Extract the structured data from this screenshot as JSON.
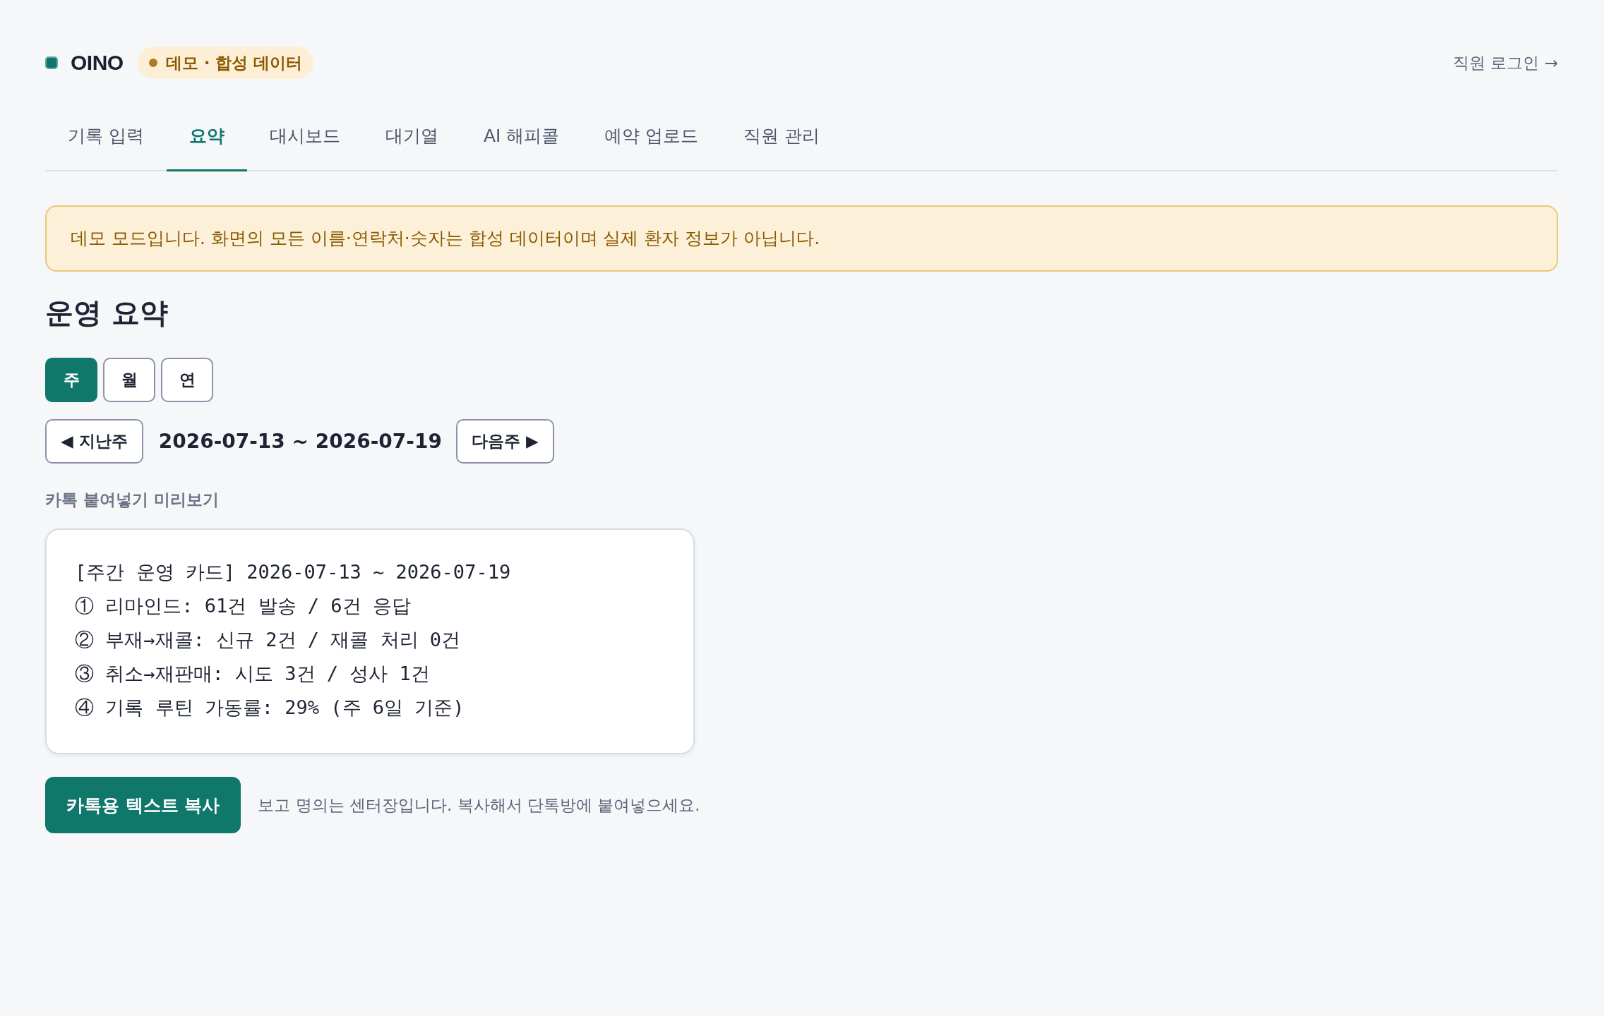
{
  "header": {
    "logo": "OINO",
    "badge": "데모 · 합성 데이터",
    "login_link": "직원 로그인 →"
  },
  "tabs": [
    {
      "label": "기록 입력",
      "selected": false
    },
    {
      "label": "요약",
      "selected": true
    },
    {
      "label": "대시보드",
      "selected": false
    },
    {
      "label": "대기열",
      "selected": false
    },
    {
      "label": "AI 해피콜",
      "selected": false
    },
    {
      "label": "예약 업로드",
      "selected": false
    },
    {
      "label": "직원 관리",
      "selected": false
    }
  ],
  "notice": "데모 모드입니다. 화면의 모든 이름·연락처·숫자는 합성 데이터이며 실제 환자 정보가 아닙니다.",
  "page_title": "운영 요약",
  "period_tabs": [
    {
      "label": "주",
      "selected": true
    },
    {
      "label": "월",
      "selected": false
    },
    {
      "label": "연",
      "selected": false
    }
  ],
  "date_nav": {
    "prev": "◀ 지난주",
    "range": "2026-07-13 ~ 2026-07-19",
    "next": "다음주 ▶"
  },
  "preview": {
    "label": "카톡 붙여넣기 미리보기",
    "lines": [
      "[주간 운영 카드] 2026-07-13 ~ 2026-07-19",
      "① 리마인드: 61건 발송 / 6건 응답",
      "② 부재→재콜: 신규 2건 / 재콜 처리 0건",
      "③ 취소→재판매: 시도 3건 / 성사 1건",
      "④ 기록 루틴 가동률: 29% (주 6일 기준)"
    ]
  },
  "copy_button": "카톡용 텍스트 복사",
  "copy_note": "보고 명의는 센터장입니다. 복사해서 단톡방에 붙여넣으세요."
}
